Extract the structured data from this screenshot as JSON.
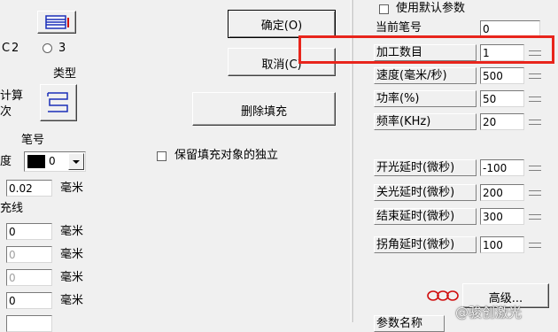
{
  "left": {
    "radio_2": "2",
    "radio_3": "3",
    "type_label": "类型",
    "calc_label": "计算",
    "times_label": "次",
    "pen_label": "笔号",
    "deg_label": "度",
    "pen_value": "0",
    "spacing_value": "0.02",
    "unit_mm": "毫米",
    "fill_line_label": "充线",
    "fields": [
      {
        "value": "0",
        "unit": "毫米",
        "disabled": false
      },
      {
        "value": "0",
        "unit": "毫米",
        "disabled": true
      },
      {
        "value": "0",
        "unit": "毫米",
        "disabled": true
      },
      {
        "value": "0",
        "unit": "毫米",
        "disabled": false
      }
    ]
  },
  "middle": {
    "ok_button": "确定(O)",
    "cancel_button": "取消(C)",
    "delete_fill_button": "删除填充",
    "keep_independent_label": "保留填充对象的独立"
  },
  "params": {
    "use_default_label": "使用默认参数",
    "current_pen_label": "当前笔号",
    "current_pen_value": "0",
    "rows": [
      {
        "label": "加工数目",
        "value": "1"
      },
      {
        "label": "速度(毫米/秒)",
        "value": "500"
      },
      {
        "label": "功率(%)",
        "value": "50"
      },
      {
        "label": "频率(KHz)",
        "value": "20"
      }
    ],
    "delay_rows": [
      {
        "label": "开光延时(微秒)",
        "value": "-100"
      },
      {
        "label": "关光延时(微秒)",
        "value": "200"
      },
      {
        "label": "结束延时(微秒)",
        "value": "300"
      }
    ],
    "corner_row": {
      "label": "拐角延时(微秒)",
      "value": "100"
    },
    "advanced_button": "高级...",
    "bottom_tab": "参数名称"
  },
  "watermark": "@骏创激光",
  "colors": {
    "highlight": "#e8251c",
    "panel": "#f0f0f0",
    "icon_blue": "#1a2fb8"
  }
}
